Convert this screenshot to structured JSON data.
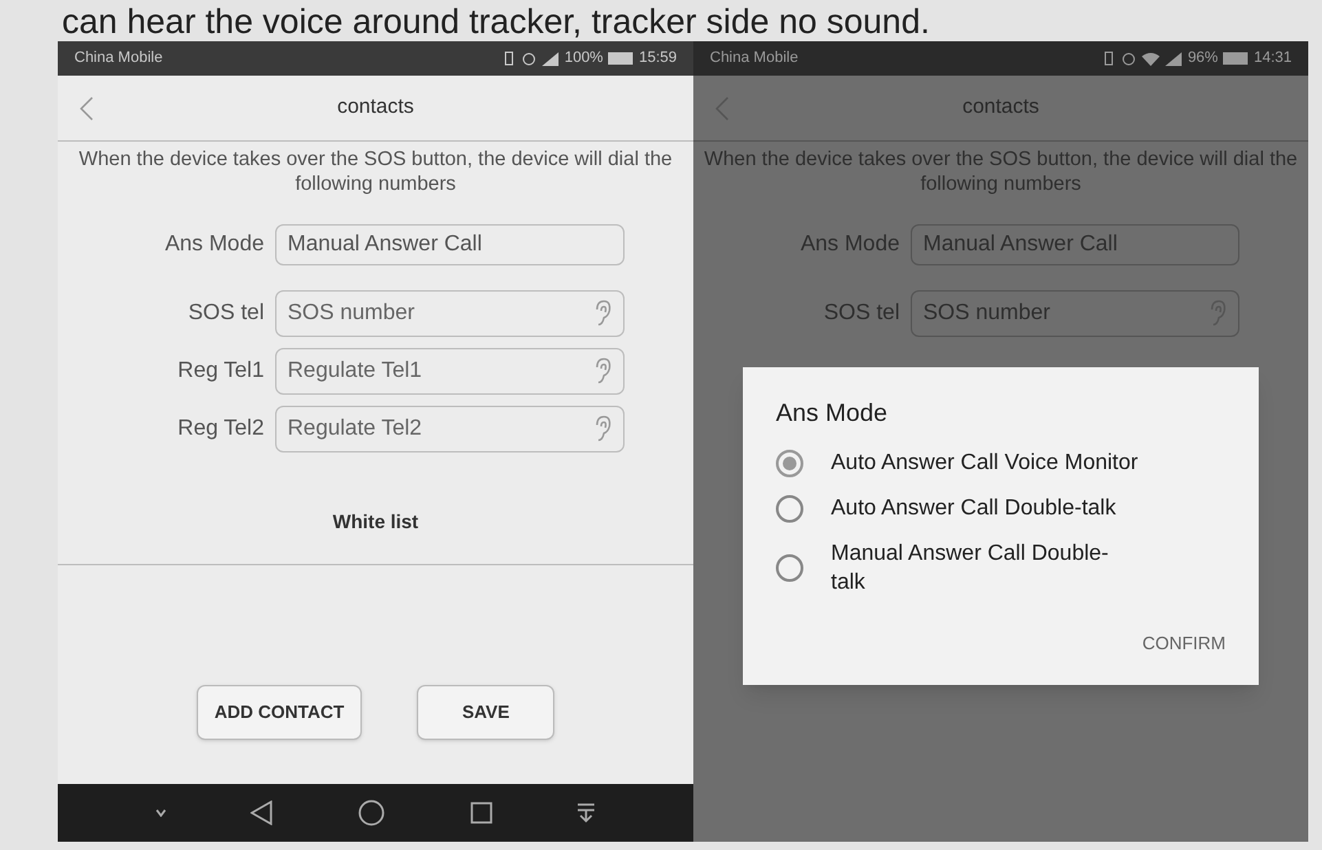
{
  "caption": "can hear the voice around tracker, tracker side no sound.",
  "screens": [
    {
      "dimmed": false,
      "status_bar": {
        "carrier": "China Mobile",
        "wifi": false,
        "battery": "100%",
        "time": "15:59"
      },
      "title": "contacts",
      "description": "When the device takes over the SOS button, the device will dial the following numbers",
      "fields": [
        {
          "kind": "select",
          "label": "Ans Mode",
          "value": "Manual Answer Call"
        },
        {
          "kind": "phone",
          "label": "SOS tel",
          "placeholder": "SOS number"
        },
        {
          "kind": "phone",
          "label": "Reg Tel1",
          "placeholder": "Regulate Tel1"
        },
        {
          "kind": "phone",
          "label": "Reg Tel2",
          "placeholder": "Regulate Tel2"
        }
      ],
      "white_list": "White list",
      "buttons": [
        "ADD CONTACT",
        "SAVE"
      ],
      "nav_bar": true
    },
    {
      "dimmed": true,
      "status_bar": {
        "carrier": "China Mobile",
        "wifi": true,
        "battery": "96%",
        "time": "14:31"
      },
      "title": "contacts",
      "description": "When the device takes over the SOS button, the device will dial the following numbers",
      "fields": [
        {
          "kind": "select",
          "label": "Ans Mode",
          "value": "Manual Answer Call"
        },
        {
          "kind": "phone",
          "label": "SOS tel",
          "placeholder": "SOS number"
        }
      ],
      "nav_bar": false,
      "dialog": {
        "title": "Ans Mode",
        "options": [
          {
            "label": "Auto Answer Call Voice Monitor",
            "selected": true
          },
          {
            "label": "Auto Answer Call Double-talk",
            "selected": false
          },
          {
            "label": "Manual Answer Call Double-talk",
            "selected": false
          }
        ],
        "action": "CONFIRM"
      }
    }
  ]
}
